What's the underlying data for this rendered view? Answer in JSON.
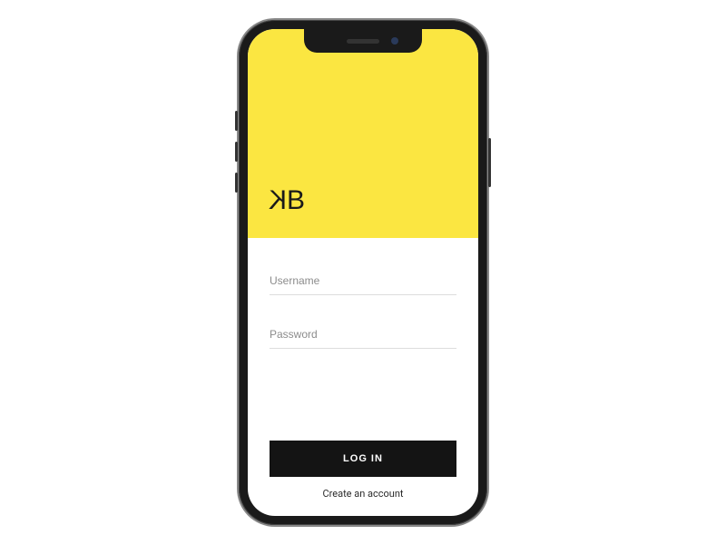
{
  "brand": {
    "logo_text": "KB"
  },
  "colors": {
    "accent": "#fbe641",
    "primary_button": "#141414"
  },
  "form": {
    "username": {
      "placeholder": "Username",
      "value": ""
    },
    "password": {
      "placeholder": "Password",
      "value": ""
    },
    "login_label": "LOG IN",
    "create_account_label": "Create an account"
  }
}
